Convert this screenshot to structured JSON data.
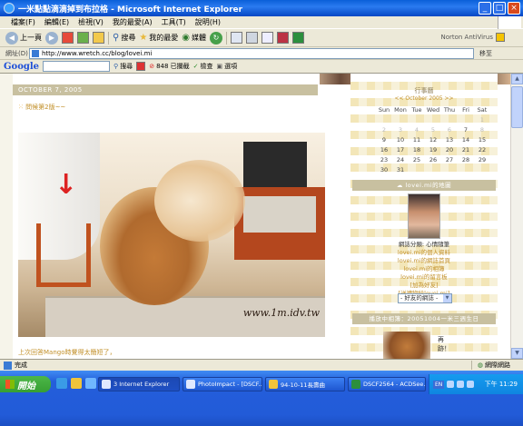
{
  "window": {
    "title": "一米點點滴滴掉到布拉格 - Microsoft Internet Explorer",
    "buttons": [
      "_",
      "□",
      "×"
    ]
  },
  "menu": [
    "檔案(F)",
    "編輯(E)",
    "檢視(V)",
    "我的最愛(A)",
    "工具(T)",
    "說明(H)"
  ],
  "toolbar": {
    "back": "上一頁",
    "search": "搜尋",
    "favorites": "我的最愛",
    "media": "媒體",
    "norton": "Norton AntiVirus"
  },
  "address": {
    "label": "網址(D)",
    "url": "http://www.wretch.cc/blog/lovei.mi",
    "go": "移至"
  },
  "google": {
    "logo": "Google",
    "search": "搜尋",
    "blocked": "848 已攔截",
    "check": "檢查",
    "options": "選項"
  },
  "post": {
    "date": "OCTOBER 7, 2005",
    "title": "問候第2版~~",
    "watermark": "www.1m.idv.tw",
    "caption": "上次回答Mango時覺得太簡短了，"
  },
  "sidebar": {
    "strip_label": "小孩報  RSS2",
    "calendar_caption": "行事曆",
    "calendar_nav": "<< October 2005 >>",
    "weekdays": [
      "Sun",
      "Mon",
      "Tue",
      "Wed",
      "Thu",
      "Fri",
      "Sat"
    ],
    "weeks": [
      [
        "",
        "",
        "",
        "",
        "",
        "",
        "1"
      ],
      [
        "2",
        "3",
        "4",
        "5",
        "6",
        "7",
        "8"
      ],
      [
        "9",
        "10",
        "11",
        "12",
        "13",
        "14",
        "15"
      ],
      [
        "16",
        "17",
        "18",
        "19",
        "20",
        "21",
        "22"
      ],
      [
        "23",
        "24",
        "25",
        "26",
        "27",
        "28",
        "29"
      ],
      [
        "30",
        "31",
        "",
        "",
        "",
        "",
        ""
      ]
    ],
    "map_heading": "lovei.mi的地圖",
    "links": [
      "網誌分類: 心情隨筆",
      "lovei.mi的個人資料",
      "lovei.mi的網誌首頁",
      "lovei.mi的相簿",
      "lovei.mi的留言板",
      "[加為好友]",
      "[送禮物給lovei.mi]"
    ],
    "friend_select": "- 好友的網誌 -",
    "countdown_heading": "播放中相簿：20051004一米三週生日",
    "thumb_text_1": "再",
    "thumb_text_2": "跡！"
  },
  "status": {
    "left": "完成",
    "zone": "網際網路"
  },
  "taskbar": {
    "start": "開始",
    "tasks": [
      "3 Internet Explorer",
      "PhotoImpact - [DSCF...",
      "94-10-11長壽曲",
      "DSCF2564 - ACDSee..."
    ],
    "lang": "EN",
    "clock": "下午 11:29"
  }
}
